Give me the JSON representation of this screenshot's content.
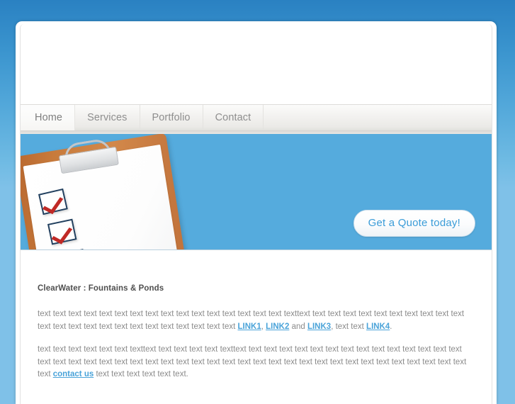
{
  "site": {
    "accent_blue": "#55abdd",
    "background_blue_top": "#2a81c2",
    "background_blue_bottom": "#7fc1e8",
    "link_color": "#4aa3d9",
    "body_text_color": "#8b8b8b"
  },
  "nav": {
    "items": [
      {
        "label": "Home",
        "active": true
      },
      {
        "label": "Services",
        "active": false
      },
      {
        "label": "Portfolio",
        "active": false
      },
      {
        "label": "Contact",
        "active": false
      }
    ]
  },
  "banner": {
    "image_name": "clipboard-checklist-illustration",
    "background_color": "#55abdd",
    "quote_button_label": "Get a Quote today!"
  },
  "content": {
    "heading": "ClearWater : Fountains & Ponds",
    "paragraph1": {
      "before": "text text text text text text text text text text text text text text text text texttext text text text text text text text text text text text text text text text text text text text text text text text ",
      "link1": "LINK1",
      "sep1": ", ",
      "link2": "LINK2",
      "sep2": " and ",
      "link3": "LINK3",
      "sep3": ", text text ",
      "link4": "LINK4",
      "after": "."
    },
    "paragraph2": {
      "before": "text text text text text text texttext text text text text texttext text text text text text text text text text text text text text text text text text text text text text text text text text text text text text text text text text text text text text text text text text text text ",
      "link": "contact us",
      "after": " text text text text text text."
    }
  }
}
